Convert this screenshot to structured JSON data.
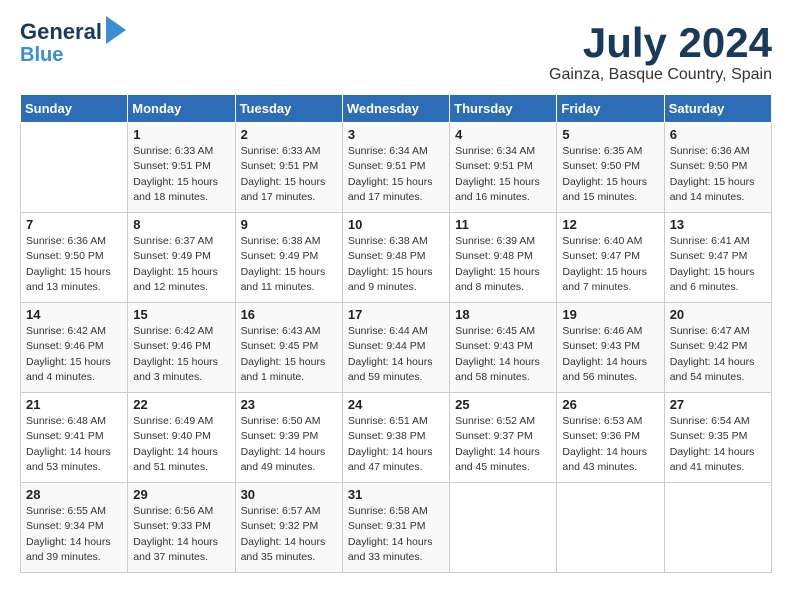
{
  "header": {
    "logo_line1": "General",
    "logo_line2": "Blue",
    "month_title": "July 2024",
    "location": "Gainza, Basque Country, Spain"
  },
  "days_of_week": [
    "Sunday",
    "Monday",
    "Tuesday",
    "Wednesday",
    "Thursday",
    "Friday",
    "Saturday"
  ],
  "weeks": [
    [
      {
        "day": "",
        "content": ""
      },
      {
        "day": "1",
        "content": "Sunrise: 6:33 AM\nSunset: 9:51 PM\nDaylight: 15 hours\nand 18 minutes."
      },
      {
        "day": "2",
        "content": "Sunrise: 6:33 AM\nSunset: 9:51 PM\nDaylight: 15 hours\nand 17 minutes."
      },
      {
        "day": "3",
        "content": "Sunrise: 6:34 AM\nSunset: 9:51 PM\nDaylight: 15 hours\nand 17 minutes."
      },
      {
        "day": "4",
        "content": "Sunrise: 6:34 AM\nSunset: 9:51 PM\nDaylight: 15 hours\nand 16 minutes."
      },
      {
        "day": "5",
        "content": "Sunrise: 6:35 AM\nSunset: 9:50 PM\nDaylight: 15 hours\nand 15 minutes."
      },
      {
        "day": "6",
        "content": "Sunrise: 6:36 AM\nSunset: 9:50 PM\nDaylight: 15 hours\nand 14 minutes."
      }
    ],
    [
      {
        "day": "7",
        "content": "Sunrise: 6:36 AM\nSunset: 9:50 PM\nDaylight: 15 hours\nand 13 minutes."
      },
      {
        "day": "8",
        "content": "Sunrise: 6:37 AM\nSunset: 9:49 PM\nDaylight: 15 hours\nand 12 minutes."
      },
      {
        "day": "9",
        "content": "Sunrise: 6:38 AM\nSunset: 9:49 PM\nDaylight: 15 hours\nand 11 minutes."
      },
      {
        "day": "10",
        "content": "Sunrise: 6:38 AM\nSunset: 9:48 PM\nDaylight: 15 hours\nand 9 minutes."
      },
      {
        "day": "11",
        "content": "Sunrise: 6:39 AM\nSunset: 9:48 PM\nDaylight: 15 hours\nand 8 minutes."
      },
      {
        "day": "12",
        "content": "Sunrise: 6:40 AM\nSunset: 9:47 PM\nDaylight: 15 hours\nand 7 minutes."
      },
      {
        "day": "13",
        "content": "Sunrise: 6:41 AM\nSunset: 9:47 PM\nDaylight: 15 hours\nand 6 minutes."
      }
    ],
    [
      {
        "day": "14",
        "content": "Sunrise: 6:42 AM\nSunset: 9:46 PM\nDaylight: 15 hours\nand 4 minutes."
      },
      {
        "day": "15",
        "content": "Sunrise: 6:42 AM\nSunset: 9:46 PM\nDaylight: 15 hours\nand 3 minutes."
      },
      {
        "day": "16",
        "content": "Sunrise: 6:43 AM\nSunset: 9:45 PM\nDaylight: 15 hours\nand 1 minute."
      },
      {
        "day": "17",
        "content": "Sunrise: 6:44 AM\nSunset: 9:44 PM\nDaylight: 14 hours\nand 59 minutes."
      },
      {
        "day": "18",
        "content": "Sunrise: 6:45 AM\nSunset: 9:43 PM\nDaylight: 14 hours\nand 58 minutes."
      },
      {
        "day": "19",
        "content": "Sunrise: 6:46 AM\nSunset: 9:43 PM\nDaylight: 14 hours\nand 56 minutes."
      },
      {
        "day": "20",
        "content": "Sunrise: 6:47 AM\nSunset: 9:42 PM\nDaylight: 14 hours\nand 54 minutes."
      }
    ],
    [
      {
        "day": "21",
        "content": "Sunrise: 6:48 AM\nSunset: 9:41 PM\nDaylight: 14 hours\nand 53 minutes."
      },
      {
        "day": "22",
        "content": "Sunrise: 6:49 AM\nSunset: 9:40 PM\nDaylight: 14 hours\nand 51 minutes."
      },
      {
        "day": "23",
        "content": "Sunrise: 6:50 AM\nSunset: 9:39 PM\nDaylight: 14 hours\nand 49 minutes."
      },
      {
        "day": "24",
        "content": "Sunrise: 6:51 AM\nSunset: 9:38 PM\nDaylight: 14 hours\nand 47 minutes."
      },
      {
        "day": "25",
        "content": "Sunrise: 6:52 AM\nSunset: 9:37 PM\nDaylight: 14 hours\nand 45 minutes."
      },
      {
        "day": "26",
        "content": "Sunrise: 6:53 AM\nSunset: 9:36 PM\nDaylight: 14 hours\nand 43 minutes."
      },
      {
        "day": "27",
        "content": "Sunrise: 6:54 AM\nSunset: 9:35 PM\nDaylight: 14 hours\nand 41 minutes."
      }
    ],
    [
      {
        "day": "28",
        "content": "Sunrise: 6:55 AM\nSunset: 9:34 PM\nDaylight: 14 hours\nand 39 minutes."
      },
      {
        "day": "29",
        "content": "Sunrise: 6:56 AM\nSunset: 9:33 PM\nDaylight: 14 hours\nand 37 minutes."
      },
      {
        "day": "30",
        "content": "Sunrise: 6:57 AM\nSunset: 9:32 PM\nDaylight: 14 hours\nand 35 minutes."
      },
      {
        "day": "31",
        "content": "Sunrise: 6:58 AM\nSunset: 9:31 PM\nDaylight: 14 hours\nand 33 minutes."
      },
      {
        "day": "",
        "content": ""
      },
      {
        "day": "",
        "content": ""
      },
      {
        "day": "",
        "content": ""
      }
    ]
  ]
}
